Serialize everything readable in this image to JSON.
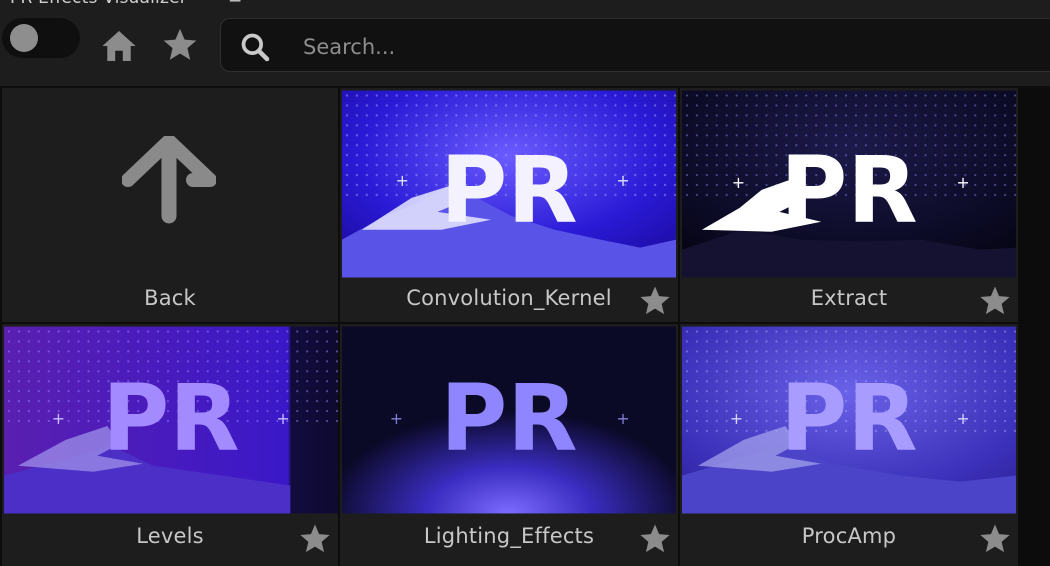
{
  "window": {
    "title": "PR Effects Visualizer",
    "menu_glyph": "≡"
  },
  "toolbar": {
    "toggle_state": "off",
    "home_icon": "home-icon",
    "favorites_icon": "star-icon",
    "search": {
      "placeholder": "Search...",
      "value": "",
      "icon": "search-icon"
    }
  },
  "colors": {
    "background": "#1d1d1d",
    "grid_gap": "#0c0c0c",
    "text": "#c7c7c7",
    "icon": "#8c8c8c"
  },
  "grid": {
    "back": {
      "label": "Back",
      "icon": "arrow-up-icon"
    },
    "effects": [
      {
        "label": "Convolution_Kernel",
        "thumb_text": "PR",
        "favorite_icon": "star-icon"
      },
      {
        "label": "Extract",
        "thumb_text": "PR",
        "favorite_icon": "star-icon"
      },
      {
        "label": "Levels",
        "thumb_text": "PR",
        "favorite_icon": "star-icon"
      },
      {
        "label": "Lighting_Effects",
        "thumb_text": "PR",
        "favorite_icon": "star-icon"
      },
      {
        "label": "ProcAmp",
        "thumb_text": "PR",
        "favorite_icon": "star-icon"
      }
    ]
  }
}
